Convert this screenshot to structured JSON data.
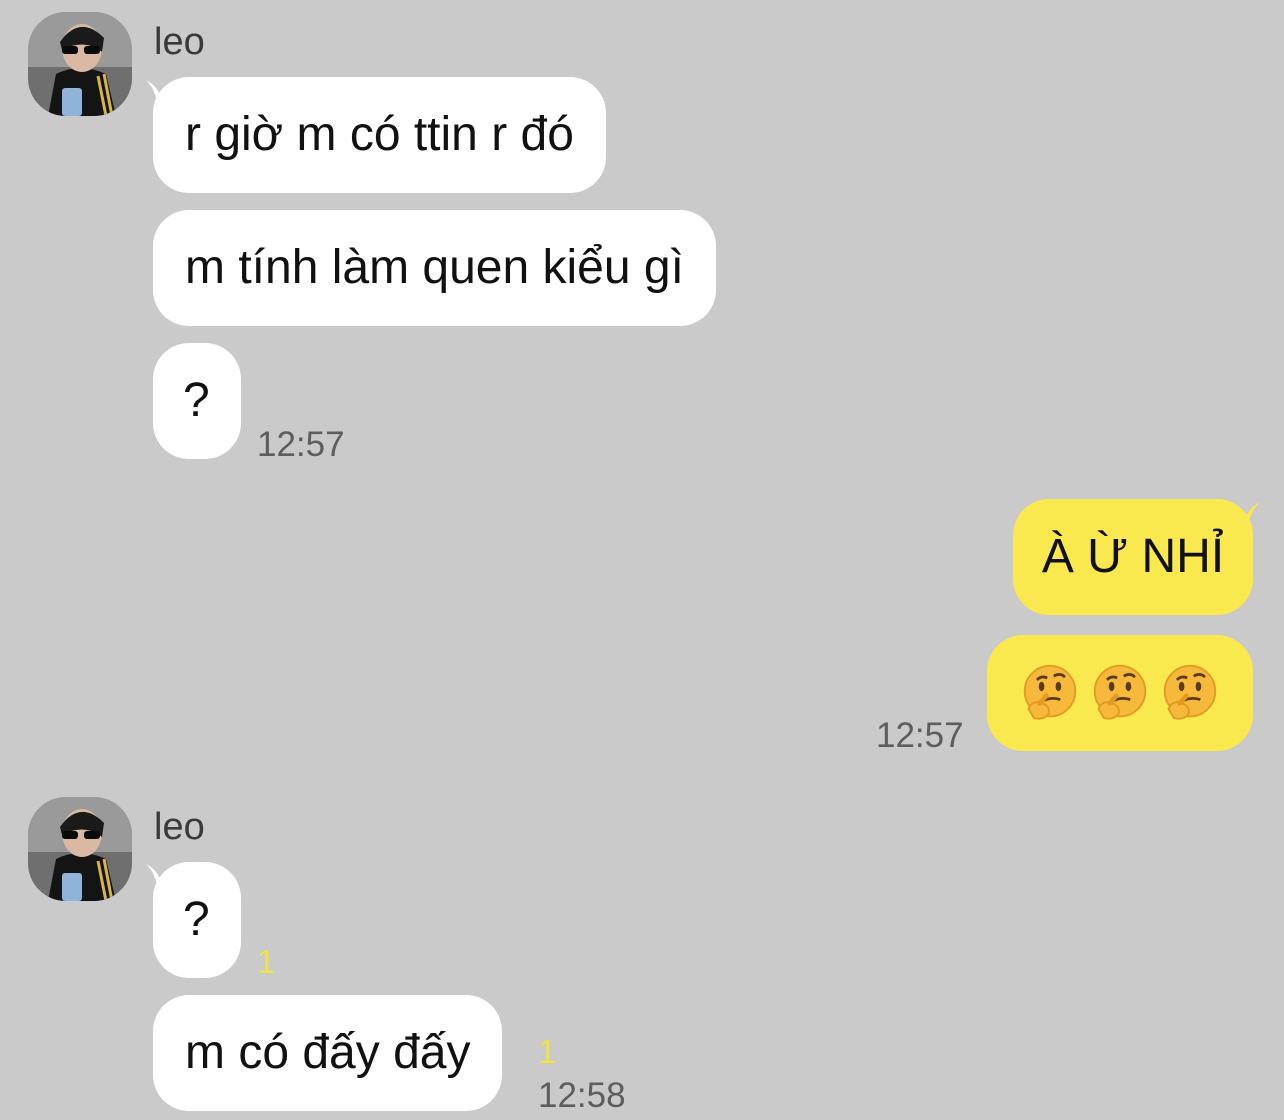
{
  "colors": {
    "background": "#cacaca",
    "incoming_bubble": "#ffffff",
    "outgoing_bubble": "#fae84f",
    "unread_count": "#f2e24a",
    "timestamp": "#5d5d5d"
  },
  "groups": [
    {
      "sender": "leo",
      "messages": [
        {
          "text": "r giờ m có ttin r đó"
        },
        {
          "text": "m tính làm quen kiểu gì"
        },
        {
          "text": "?",
          "time": "12:57"
        }
      ]
    },
    {
      "outgoing": true,
      "messages": [
        {
          "text": "À Ừ NHỈ"
        },
        {
          "emoji": [
            "thinking-face-icon",
            "thinking-face-icon",
            "thinking-face-icon"
          ],
          "time": "12:57"
        }
      ]
    },
    {
      "sender": "leo",
      "messages": [
        {
          "text": "?",
          "unread": "1"
        },
        {
          "text": "m có đấy đấy",
          "unread": "1",
          "time": "12:58"
        }
      ]
    }
  ]
}
